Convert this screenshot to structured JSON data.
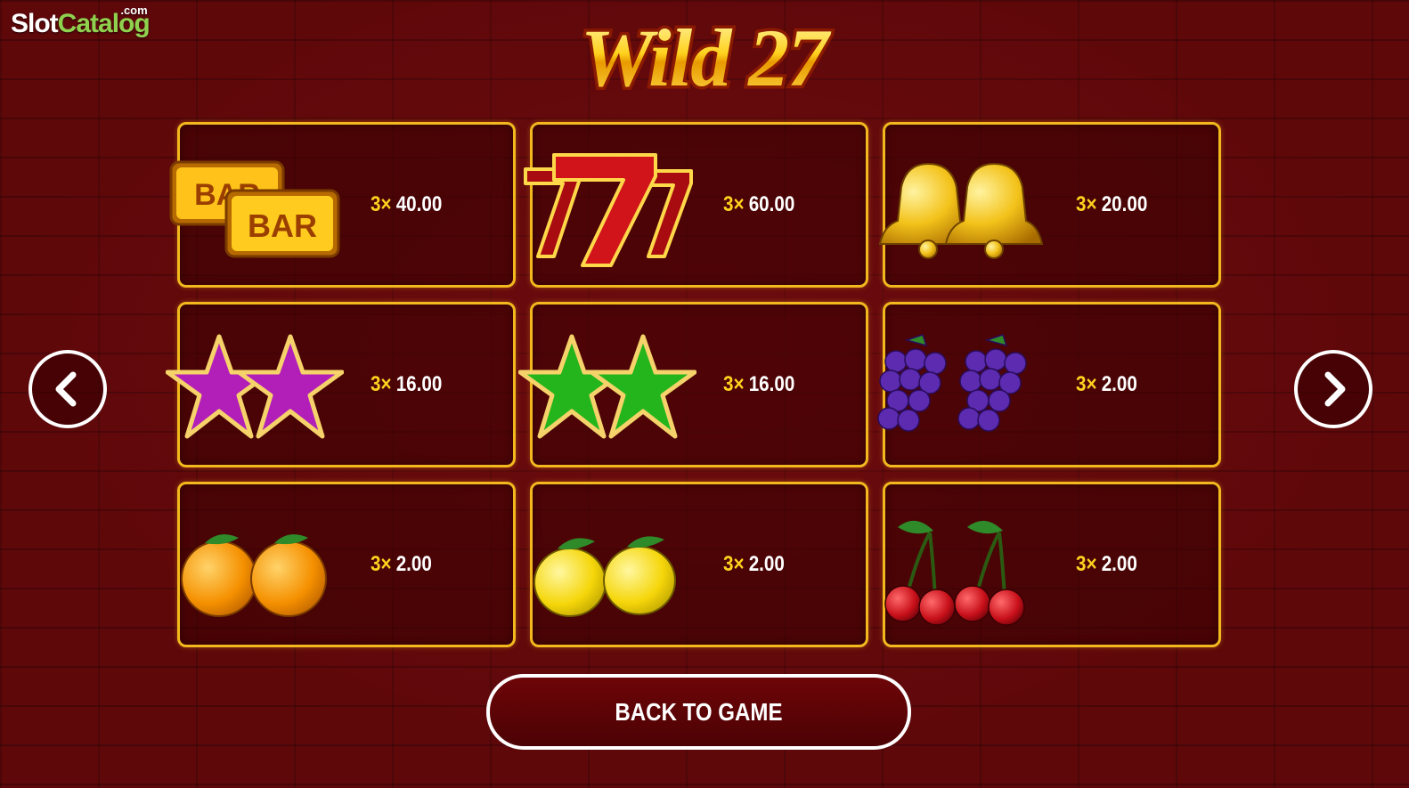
{
  "watermark": {
    "part1": "Slot",
    "part2": "Catalog",
    "suffix": ".com"
  },
  "game": {
    "title": "Wild 27"
  },
  "navigation": {
    "prev_icon": "chevron-left-icon",
    "next_icon": "chevron-right-icon"
  },
  "paytable": [
    {
      "symbol": "bar",
      "multiplier": "3×",
      "payout": "40.00"
    },
    {
      "symbol": "seven",
      "multiplier": "3×",
      "payout": "60.00"
    },
    {
      "symbol": "bell",
      "multiplier": "3×",
      "payout": "20.00"
    },
    {
      "symbol": "purple-star",
      "multiplier": "3×",
      "payout": "16.00"
    },
    {
      "symbol": "green-star",
      "multiplier": "3×",
      "payout": "16.00"
    },
    {
      "symbol": "grapes",
      "multiplier": "3×",
      "payout": "2.00"
    },
    {
      "symbol": "orange",
      "multiplier": "3×",
      "payout": "2.00"
    },
    {
      "symbol": "lemon",
      "multiplier": "3×",
      "payout": "2.00"
    },
    {
      "symbol": "cherry",
      "multiplier": "3×",
      "payout": "2.00"
    }
  ],
  "back_button": {
    "label": "BACK TO GAME"
  },
  "colors": {
    "background": "#5e080a",
    "cell_border": "#f2b81e",
    "multiplier": "#ffd21f",
    "text": "#ffffff"
  }
}
